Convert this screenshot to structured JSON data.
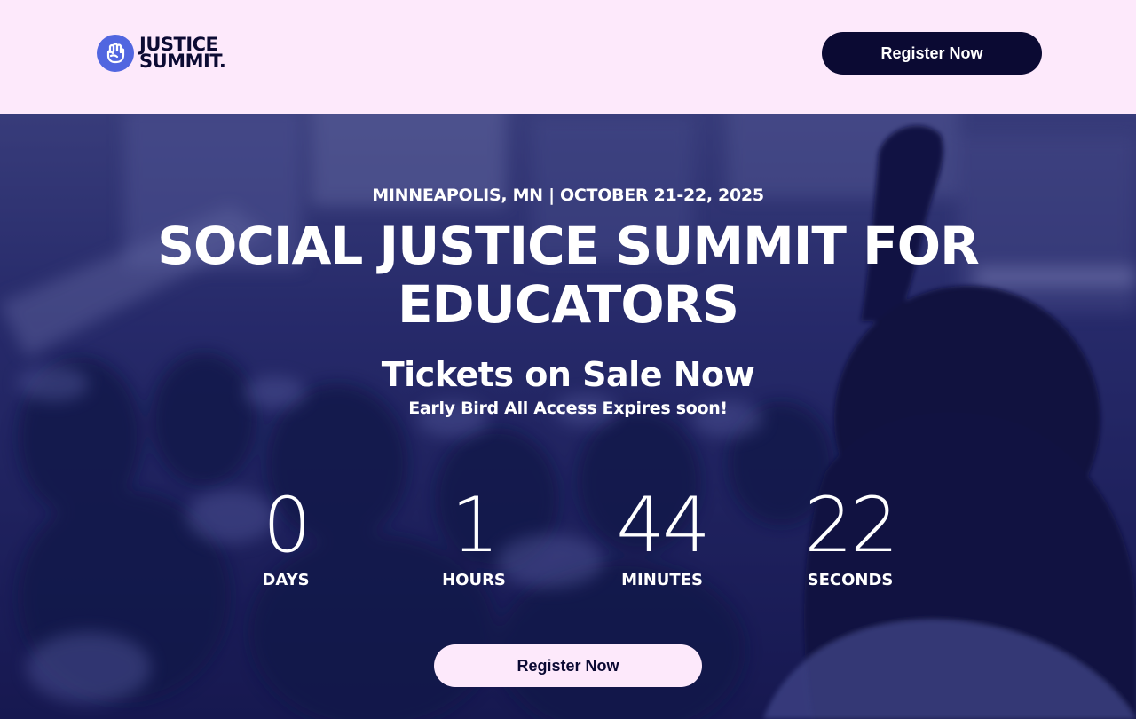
{
  "header": {
    "logo_line1": "JUSTICE",
    "logo_line2": "SUMMIT",
    "logo_dot": ".",
    "register_label": "Register Now"
  },
  "hero": {
    "location_date": "MINNEAPOLIS, MN | OCTOBER 21-22, 2025",
    "title": "SOCIAL JUSTICE SUMMIT FOR EDUCATORS",
    "tickets_heading": "Tickets on Sale Now",
    "early_bird": "Early Bird All Access Expires soon!",
    "countdown": [
      {
        "value": "0",
        "label": "DAYS"
      },
      {
        "value": "1",
        "label": "HOURS"
      },
      {
        "value": "44",
        "label": "MINUTES"
      },
      {
        "value": "22",
        "label": "SECONDS"
      }
    ],
    "register_label": "Register Now"
  },
  "colors": {
    "background_pink": "#fde9fb",
    "navy": "#0b0a33",
    "brand_blue": "#5166e0",
    "hero_overlay": "#1a1c5a"
  },
  "icons": {
    "logo": "raised-fist-icon"
  }
}
